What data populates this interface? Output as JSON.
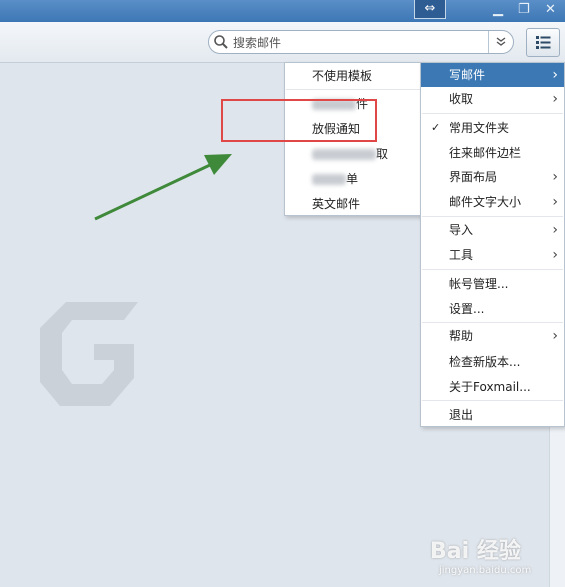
{
  "window": {
    "swap_glyph": "⇔",
    "minimize_glyph": "▁",
    "restore_glyph": "❐",
    "close_glyph": "✕"
  },
  "search": {
    "placeholder": "搜索邮件",
    "dropdown_glyph": "⌄",
    "icon": "search-icon"
  },
  "main_menu": {
    "icon": "list-menu-icon",
    "items": [
      {
        "label": "写邮件",
        "submenu": true,
        "highlighted": true
      },
      {
        "label": "收取",
        "submenu": true
      },
      {
        "label": "常用文件夹",
        "checked": true
      },
      {
        "label": "往来邮件边栏"
      },
      {
        "label": "界面布局",
        "submenu": true
      },
      {
        "label": "邮件文字大小",
        "submenu": true
      },
      {
        "label": "导入",
        "submenu": true
      },
      {
        "label": "工具",
        "submenu": true
      },
      {
        "label": "帐号管理..."
      },
      {
        "label": "设置..."
      },
      {
        "label": "帮助",
        "submenu": true
      },
      {
        "label": "检查新版本..."
      },
      {
        "label": "关于Foxmail..."
      },
      {
        "label": "退出"
      }
    ],
    "arrow_glyph": "›",
    "check_glyph": "✓"
  },
  "compose_submenu": {
    "items": [
      {
        "label": "不使用模板"
      },
      {
        "label": "件",
        "obscured": true
      },
      {
        "label": "放假通知"
      },
      {
        "label": "取",
        "obscured": true
      },
      {
        "label": "单",
        "obscured": true
      },
      {
        "label": "英文邮件"
      }
    ]
  },
  "colors": {
    "highlight": "#3c79b4",
    "annotation_box": "#e04848",
    "annotation_arrow": "#3f8a3a"
  },
  "watermark": {
    "logo": "Bai 经验",
    "text": "jingyan.baidu.com"
  }
}
